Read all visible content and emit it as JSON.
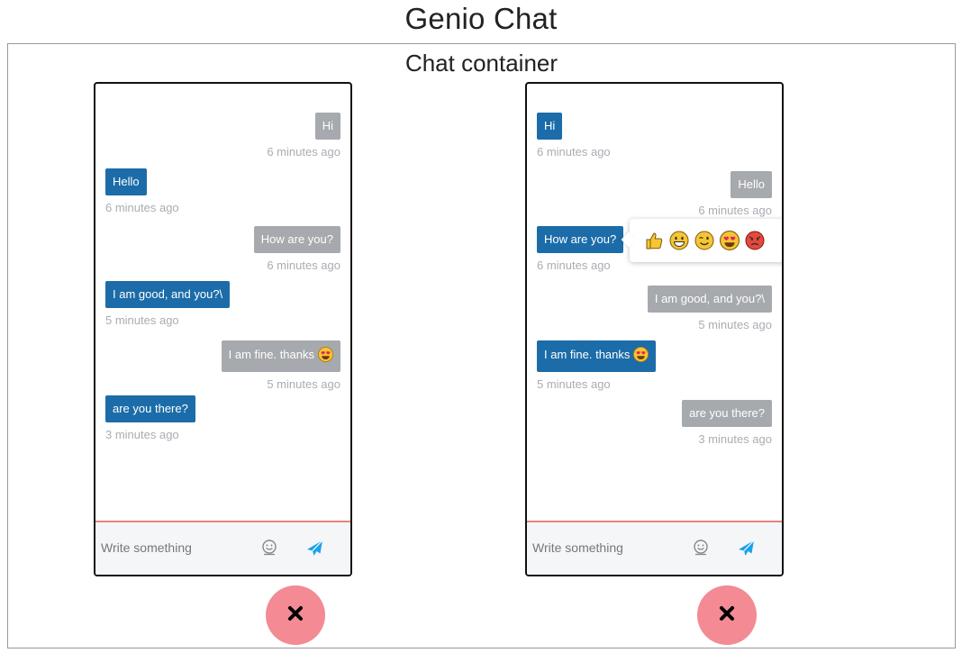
{
  "header": {
    "title": "Genio Chat"
  },
  "container": {
    "title": "Chat container"
  },
  "left_chat": {
    "messages": [
      {
        "text": "Hi",
        "time": "6 minutes ago",
        "side": "me",
        "color": "gray"
      },
      {
        "text": "Hello",
        "time": "6 minutes ago",
        "side": "them",
        "color": "blue"
      },
      {
        "text": "How are you?",
        "time": "6 minutes ago",
        "side": "me",
        "color": "gray"
      },
      {
        "text": "I am good, and you?\\",
        "time": "5 minutes ago",
        "side": "them",
        "color": "blue"
      },
      {
        "text": "I am fine. thanks",
        "emoji": "heart-eyes",
        "time": "5 minutes ago",
        "side": "me",
        "color": "gray"
      },
      {
        "text": "are you there?",
        "time": "3 minutes ago",
        "side": "them",
        "color": "blue"
      }
    ],
    "composer": {
      "placeholder": "Write something"
    }
  },
  "right_chat": {
    "messages": [
      {
        "text": "Hi",
        "time": "6 minutes ago",
        "side": "them",
        "color": "blue"
      },
      {
        "text": "Hello",
        "time": "6 minutes ago",
        "side": "me",
        "color": "gray"
      },
      {
        "text": "How are you?",
        "time": "6 minutes ago",
        "side": "them",
        "color": "blue"
      },
      {
        "text": "I am good, and you?\\",
        "time": "5 minutes ago",
        "side": "me",
        "color": "gray"
      },
      {
        "text": "I am fine. thanks",
        "emoji": "heart-eyes",
        "time": "5 minutes ago",
        "side": "them",
        "color": "blue"
      },
      {
        "text": "are you there?",
        "time": "3 minutes ago",
        "side": "me",
        "color": "gray"
      }
    ],
    "composer": {
      "placeholder": "Write something"
    },
    "reaction_popup": {
      "reactions": [
        "thumbs-up",
        "grinning",
        "winking",
        "heart-eyes",
        "angry"
      ]
    }
  },
  "colors": {
    "bubble_blue": "#1b6ca8",
    "bubble_gray": "#a6a9ad",
    "timestamp": "#a9adb2",
    "composer_border": "#e8837f",
    "send_icon": "#1aa3e8",
    "close_button": "#f38a94"
  }
}
